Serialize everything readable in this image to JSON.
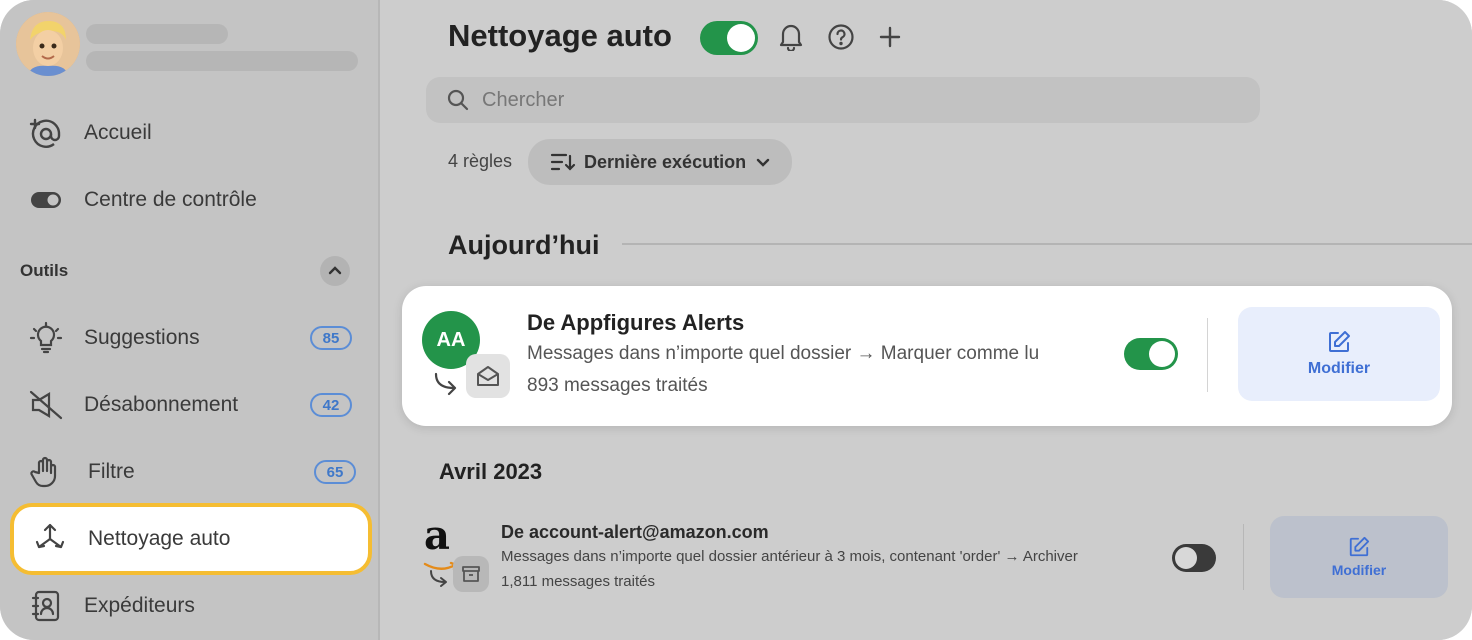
{
  "sidebar": {
    "nav": [
      {
        "label": "Accueil",
        "icon": "at-icon"
      },
      {
        "label": "Centre de contrôle",
        "icon": "toggle-icon"
      }
    ],
    "section_label": "Outils",
    "tools": [
      {
        "label": "Suggestions",
        "icon": "lightbulb-icon",
        "badge": "85"
      },
      {
        "label": "Désabonnement",
        "icon": "unsubscribe-icon",
        "badge": "42"
      },
      {
        "label": "Filtre",
        "icon": "hand-icon",
        "badge": "65"
      },
      {
        "label": "Nettoyage auto",
        "icon": "auto-clean-icon"
      },
      {
        "label": "Expéditeurs",
        "icon": "contacts-icon"
      }
    ],
    "active_color": "#f5bd32"
  },
  "header": {
    "title": "Nettoyage auto",
    "toggle_on": true
  },
  "search": {
    "placeholder": "Chercher"
  },
  "toolbar": {
    "rules_count": "4 règles",
    "sort_label": "Dernière exécution"
  },
  "sections": {
    "today": "Aujourd’hui",
    "april": "Avril 2023"
  },
  "rules": [
    {
      "avatar_text": "AA",
      "title": "De Appfigures Alerts",
      "description": "Messages dans n’importe quel dossier → Marquer comme lu",
      "processed": "893 messages traités",
      "enabled": true,
      "edit_label": "Modifier"
    },
    {
      "avatar_text": "a",
      "title": "De account-alert@amazon.com",
      "description": "Messages dans n’importe quel dossier  antérieur à 3 mois, contenant 'order' → Archiver",
      "processed": "1,811 messages traités",
      "enabled": false,
      "edit_label": "Modifier"
    }
  ],
  "colors": {
    "accent_green": "#23944a",
    "accent_blue": "#3f6fd4",
    "highlight_yellow": "#f5bd32"
  }
}
